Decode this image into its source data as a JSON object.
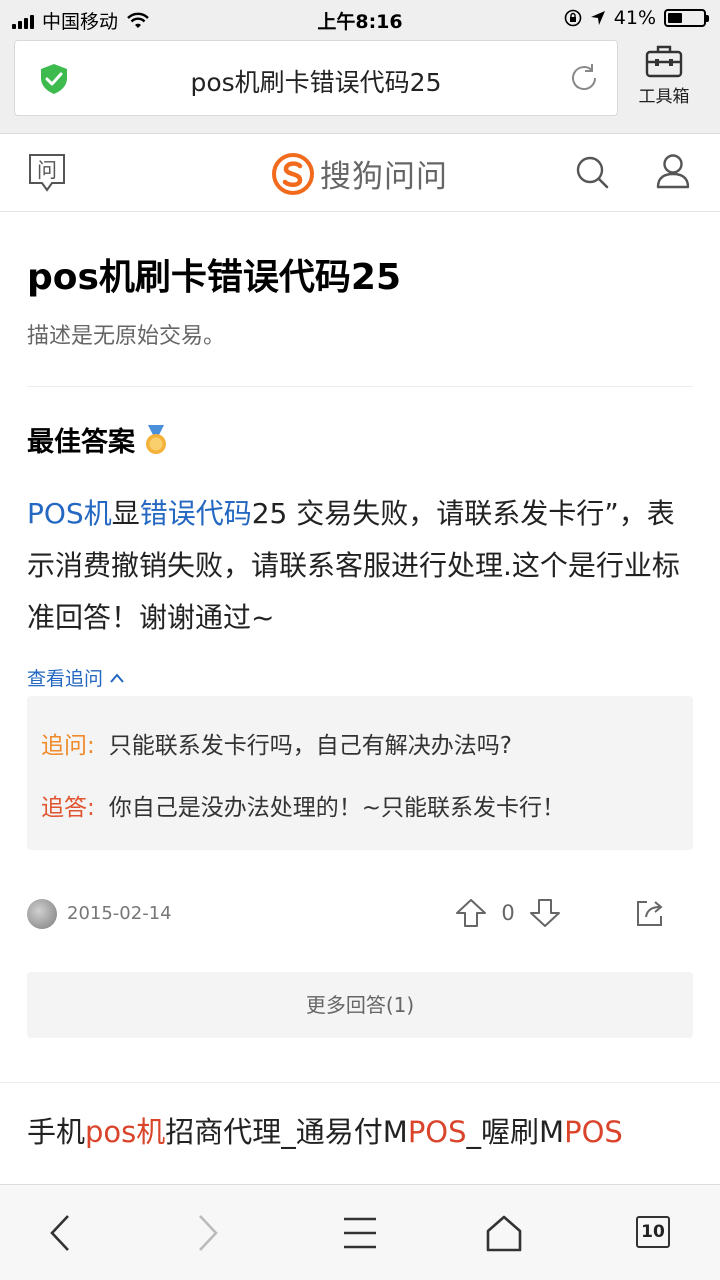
{
  "status_bar": {
    "carrier": "中国移动",
    "time": "上午8:16",
    "battery": "41%",
    "battery_level": 0.41
  },
  "browser": {
    "url_text": "pos机刷卡错误代码25",
    "toolbox_label": "工具箱"
  },
  "site": {
    "ask_icon_glyph": "问",
    "brand_name": "搜狗问问",
    "brand_color": "#f26b1d"
  },
  "question": {
    "title": "pos机刷卡错误代码25",
    "description": "描述是无原始交易。"
  },
  "best_answer": {
    "heading": "最佳答案",
    "text_parts": {
      "kw1": "POS机",
      "p1": "显",
      "kw2": "错误代码",
      "p2": "25  交易失败，请联系发卡行”，表示消费撤销失败，请联系客服进行处理.这个是行业标准回答！谢谢通过~"
    },
    "view_follow_label": "查看追问",
    "follow_up": [
      {
        "tag": "追问:",
        "text": "只能联系发卡行吗，自己有解决办法吗?"
      },
      {
        "tag": "追答:",
        "text": "你自己是没办法处理的！~只能联系发卡行！"
      }
    ],
    "date": "2015-02-14",
    "vote_count": "0"
  },
  "more_answers_label": "更多回答(1)",
  "ad": {
    "parts": {
      "a": "手机",
      "b": "pos机",
      "c": "招商代理_通易付M",
      "d": "POS",
      "e": "_喔刷M",
      "f": "POS"
    }
  },
  "bottom_bar": {
    "tab_count": "10"
  },
  "colors": {
    "link_blue": "#2468c1",
    "follow_ask": "#f08a2a",
    "follow_answer": "#e0542f",
    "ad_highlight": "#d9442b"
  }
}
